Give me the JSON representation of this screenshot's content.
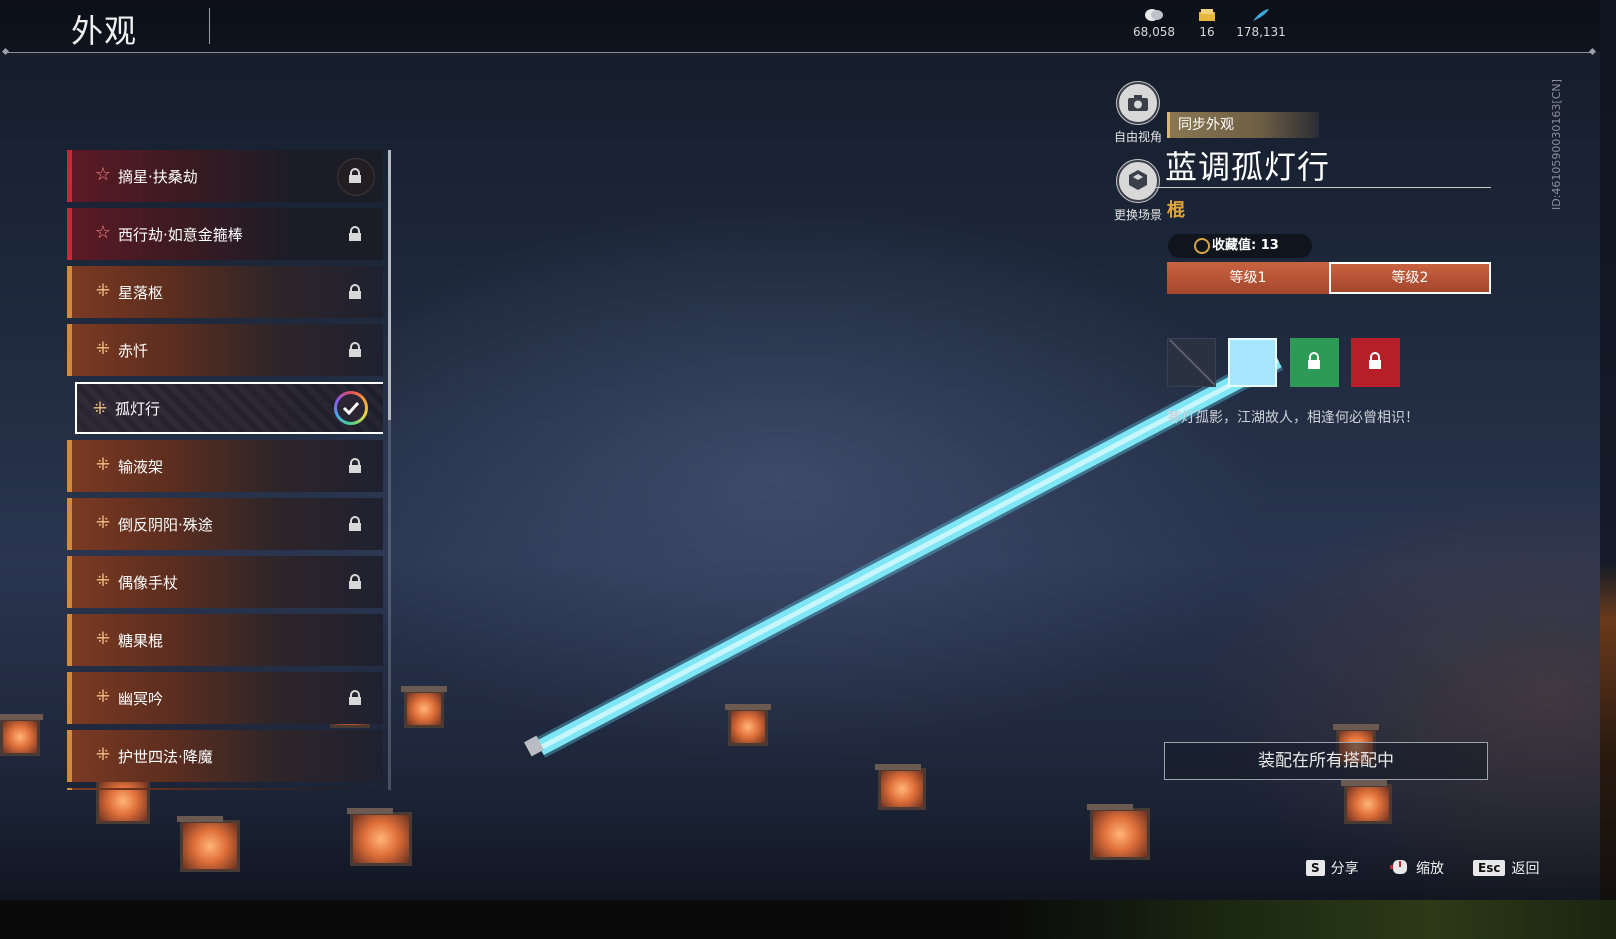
{
  "header": {
    "title": "外观",
    "currencies": [
      {
        "icon": "coin-icon",
        "value": "68,058"
      },
      {
        "icon": "ticket-icon",
        "value": "16"
      },
      {
        "icon": "feather-icon",
        "value": "178,131"
      }
    ]
  },
  "list": {
    "items": [
      {
        "label": "摘星·扶桑劫",
        "mark": "star-icon",
        "locked": true
      },
      {
        "label": "西行劫·如意金箍棒",
        "mark": "star-icon",
        "locked": true
      },
      {
        "label": "星落枢",
        "mark": "rank-icon",
        "locked": true
      },
      {
        "label": "赤忏",
        "mark": "rank-icon",
        "locked": true
      },
      {
        "label": "孤灯行",
        "mark": "rank-icon",
        "locked": false,
        "selected": true
      },
      {
        "label": "输液架",
        "mark": "rank-icon",
        "locked": true
      },
      {
        "label": "倒反阴阳·殊途",
        "mark": "rank-icon",
        "locked": true
      },
      {
        "label": "偶像手杖",
        "mark": "rank-icon",
        "locked": true
      },
      {
        "label": "糖果棍",
        "mark": "rank-icon",
        "locked": false
      },
      {
        "label": "幽冥吟",
        "mark": "rank-icon",
        "locked": true
      },
      {
        "label": "护世四法·降魔",
        "mark": "rank-icon",
        "locked": false
      }
    ]
  },
  "view_buttons": {
    "free_view": "自由视角",
    "change_scene": "更换场景"
  },
  "detail": {
    "tag": "同步外观",
    "name": "蓝调孤灯行",
    "type": "棍",
    "collect_label": "收藏值: 13",
    "levels": [
      "等级1",
      "等级2"
    ],
    "active_level": 1,
    "swatches": [
      {
        "name": "none",
        "color": "#2a3140",
        "locked": false
      },
      {
        "name": "light-blue",
        "color": "#a6e6ff",
        "locked": false,
        "selected": true
      },
      {
        "name": "green",
        "color": "#2e9a58",
        "locked": true
      },
      {
        "name": "red",
        "color": "#b81e28",
        "locked": true
      }
    ],
    "description": "寒灯孤影，江湖故人，相逢何必曾相识！",
    "equip_all": "装配在所有搭配中"
  },
  "footer": {
    "share_key": "S",
    "share_label": "分享",
    "zoom_label": "缩放",
    "back_key": "Esc",
    "back_label": "返回"
  },
  "id_text": "ID:4610590030163[CN]"
}
